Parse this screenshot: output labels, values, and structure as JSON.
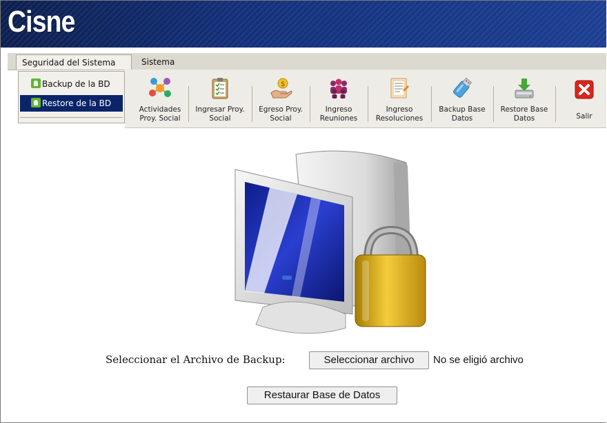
{
  "app": {
    "brand": "Cisne"
  },
  "menu": {
    "tabs": [
      {
        "label": "Seguridad del Sistema"
      },
      {
        "label": "Sistema"
      }
    ],
    "dropdown": [
      {
        "label": "Backup de la BD",
        "icon": "user-green-icon"
      },
      {
        "label": "Restore de la BD",
        "icon": "user-green-icon",
        "selected": true
      }
    ]
  },
  "toolbar": {
    "buttons": [
      {
        "line1": "Actividades",
        "line2": "Proy. Social",
        "icon": "network-people-icon"
      },
      {
        "line1": "Ingresar Proy.",
        "line2": "Social",
        "icon": "clipboard-checklist-icon"
      },
      {
        "line1": "Egreso Proy.",
        "line2": "Social",
        "icon": "hand-money-icon"
      },
      {
        "line1": "Ingreso",
        "line2": "Reuniones",
        "icon": "group-meeting-icon"
      },
      {
        "line1": "Ingreso",
        "line2": "Resoluciones",
        "icon": "document-list-icon"
      },
      {
        "line1": "Backup Base",
        "line2": "Datos",
        "icon": "usb-drive-icon"
      },
      {
        "line1": "Restore Base",
        "line2": "Datos",
        "icon": "download-drive-icon"
      },
      {
        "line1": "Salir",
        "line2": "",
        "icon": "close-icon"
      }
    ]
  },
  "form": {
    "file_label": "Seleccionar el Archivo de Backup:",
    "file_button": "Seleccionar archivo",
    "file_status": "No se eligió archivo",
    "restore_button": "Restaurar Base de Datos"
  },
  "colors": {
    "banner": "#13307a",
    "selection": "#0a246a",
    "exit_red": "#d9261c"
  }
}
